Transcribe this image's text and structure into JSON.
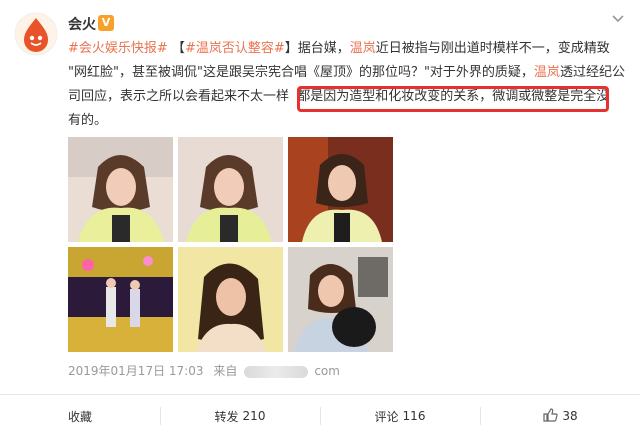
{
  "user": {
    "name": "会火",
    "verified_badge": "V"
  },
  "post": {
    "line1": {
      "tag": "#会火娱乐快报#",
      "bracket_open": " 【",
      "topic": "#温岚否认整容#",
      "bracket_close": "】据台媒，",
      "name": "温岚",
      "rest": "近日被指与刚出道时模样不一，变成精致"
    },
    "line2": {
      "text_a": "\"网红脸\"，甚至被调侃\"这是跟吴宗宪合唱《屋顶》的那位吗？\"对于外界的质疑，",
      "name": "温岚",
      "text_b": "透过经纪公"
    },
    "line3": {
      "text_a": "司回应，表示之所以会看起来不太一样",
      "highlight": "都是因为造型和化妆改变的关系，微调或微整是完全没"
    },
    "line4": {
      "text": "有的。"
    }
  },
  "meta": {
    "date": "2019年01月17日 17:03",
    "from": "来自",
    "suffix": "com"
  },
  "actions": {
    "favorite": "收藏",
    "repost_label": "转发",
    "repost_count": "210",
    "comment_label": "评论",
    "comment_count": "116",
    "like_count": "38"
  },
  "colors": {
    "link": "#eb7350",
    "highlight_border": "#e8302f",
    "badge": "#f7a12a"
  }
}
